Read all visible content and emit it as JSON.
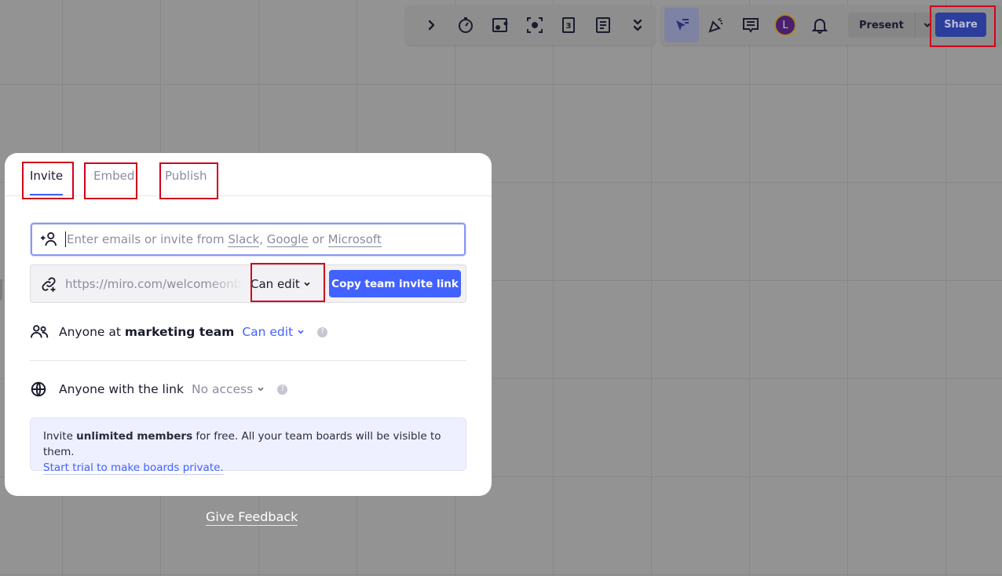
{
  "toolbar_left": {
    "items": [
      {
        "name": "expand-chevron-icon",
        "glyph": "›"
      },
      {
        "name": "timer-icon"
      },
      {
        "name": "voting-icon"
      },
      {
        "name": "attention-focus-icon"
      },
      {
        "name": "card-count-icon",
        "label": "3"
      },
      {
        "name": "notes-icon"
      },
      {
        "name": "more-chevrons-icon"
      }
    ]
  },
  "toolbar_right": {
    "items": [
      {
        "name": "cursor-select-icon",
        "active": true
      },
      {
        "name": "celebrate-icon"
      },
      {
        "name": "comments-icon"
      },
      {
        "name": "avatar",
        "initial": "L"
      },
      {
        "name": "bell-icon"
      }
    ],
    "present_label": "Present",
    "share_label": "Share"
  },
  "dialog": {
    "tabs": [
      {
        "label": "Invite",
        "active": true
      },
      {
        "label": "Embed",
        "active": false
      },
      {
        "label": "Publish",
        "active": false
      }
    ],
    "email_input": {
      "placeholder_prefix": "Enter emails or invite from ",
      "slack": "Slack",
      "comma": ",",
      "google": "Google",
      "or": " or ",
      "microsoft": "Microsoft"
    },
    "invite_link": {
      "url": "https://miro.com/welcomeonboard/",
      "permission": "Can edit",
      "copy_label": "Copy team invite link"
    },
    "team_access": {
      "prefix": "Anyone at ",
      "team": "marketing team",
      "permission": "Can edit",
      "help": "?"
    },
    "link_access": {
      "label": "Anyone with the link",
      "permission": "No access",
      "help": "?"
    },
    "info": {
      "text_prefix": "Invite ",
      "bold": "unlimited members",
      "text_suffix": " for free. All your team boards will be visible to them.",
      "link": "Start trial to make boards private."
    }
  },
  "feedback_label": "Give Feedback",
  "colors": {
    "accent": "#4262ff",
    "share_button": "#2c3e9c",
    "highlight": "#d0021b",
    "overlay_bg": "#939393"
  }
}
